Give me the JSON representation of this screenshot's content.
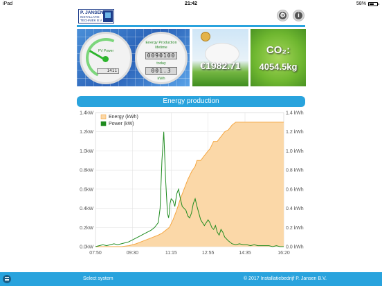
{
  "status_bar": {
    "device": "iPad",
    "time": "21:42",
    "battery": "58%",
    "battery_level": 0.58
  },
  "logo": {
    "line1": "P. JANSEN",
    "line2": "INSTALLATIE",
    "line3": "TECHNIEK B.V."
  },
  "tiles": {
    "pv_power": {
      "gauge_label": "PV Power",
      "gauge_digits": "1411",
      "meter_title_1": "Energy Production",
      "meter_title_2": "lifetime",
      "lifetime_value": "0090100",
      "today_label": "today",
      "today_value": "001.3",
      "unit": "kWh"
    },
    "money": {
      "value": "€1982.71"
    },
    "co2": {
      "label": "CO₂:",
      "value": "4054.5kg"
    }
  },
  "chart_section": {
    "title": "Energy production"
  },
  "chart_data": {
    "type": "line",
    "title": "",
    "legend": {
      "placement": "top-left",
      "entries": [
        "Energy (kWh)",
        "Power (kW)"
      ]
    },
    "x_tick_labels": [
      "07:50",
      "09:30",
      "11:15",
      "12:55",
      "14:35",
      "16:20"
    ],
    "x_tick_minutes": [
      470,
      570,
      675,
      775,
      875,
      980
    ],
    "xlim": [
      470,
      980
    ],
    "left_axis": {
      "unit": "kW",
      "ylim": [
        0,
        1.4
      ],
      "ticks": [
        "0.0kW",
        "0.2kW",
        "0.4kW",
        "0.6kW",
        "0.8kW",
        "1.0kW",
        "1.2kW",
        "1.4kW"
      ]
    },
    "right_axis": {
      "unit": "kWh",
      "ylim": [
        0,
        1.4
      ],
      "ticks": [
        "0.0 kWh",
        "0.2 kWh",
        "0.4 kWh",
        "0.6 kWh",
        "0.8 kWh",
        "1.0 kWh",
        "1.2 kWh",
        "1.4 kWh"
      ]
    },
    "grid": true,
    "series": [
      {
        "name": "Energy (kWh)",
        "type": "area",
        "color": "#f5a742",
        "fill": "#fbd8a8",
        "x": [
          470,
          540,
          560,
          580,
          600,
          620,
          640,
          650,
          660,
          670,
          680,
          690,
          700,
          710,
          720,
          730,
          740,
          745,
          755,
          765,
          775,
          780,
          790,
          800,
          810,
          820,
          830,
          840,
          850,
          860,
          870,
          900,
          930,
          960,
          980
        ],
        "y": [
          0.0,
          0.0,
          0.01,
          0.03,
          0.06,
          0.09,
          0.12,
          0.14,
          0.17,
          0.2,
          0.28,
          0.38,
          0.5,
          0.6,
          0.7,
          0.78,
          0.84,
          0.9,
          0.9,
          0.95,
          1.0,
          1.02,
          1.1,
          1.1,
          1.15,
          1.2,
          1.22,
          1.27,
          1.3,
          1.3,
          1.3,
          1.3,
          1.3,
          1.3,
          1.3
        ]
      },
      {
        "name": "Power (kW)",
        "type": "line",
        "color": "#1e8b1e",
        "x": [
          470,
          480,
          490,
          500,
          510,
          520,
          530,
          540,
          550,
          560,
          570,
          580,
          590,
          600,
          610,
          620,
          630,
          640,
          645,
          650,
          655,
          660,
          665,
          668,
          670,
          672,
          675,
          680,
          685,
          690,
          695,
          700,
          705,
          710,
          715,
          720,
          725,
          730,
          735,
          740,
          745,
          750,
          755,
          760,
          765,
          770,
          775,
          780,
          785,
          790,
          795,
          800,
          805,
          810,
          815,
          820,
          830,
          840,
          850,
          860,
          870,
          880,
          890,
          900,
          910,
          920,
          930,
          940,
          950,
          960,
          970,
          980
        ],
        "y": [
          0.0,
          0.01,
          0.02,
          0.01,
          0.02,
          0.03,
          0.02,
          0.03,
          0.04,
          0.05,
          0.07,
          0.09,
          0.11,
          0.13,
          0.15,
          0.17,
          0.2,
          0.25,
          0.4,
          0.9,
          1.2,
          0.7,
          0.35,
          0.3,
          0.35,
          0.45,
          0.5,
          0.48,
          0.42,
          0.55,
          0.6,
          0.5,
          0.42,
          0.4,
          0.38,
          0.32,
          0.3,
          0.35,
          0.45,
          0.5,
          0.42,
          0.35,
          0.28,
          0.25,
          0.22,
          0.25,
          0.28,
          0.25,
          0.2,
          0.18,
          0.22,
          0.15,
          0.12,
          0.18,
          0.15,
          0.1,
          0.06,
          0.03,
          0.02,
          0.03,
          0.02,
          0.02,
          0.01,
          0.02,
          0.01,
          0.01,
          0.01,
          0.01,
          0.0,
          0.01,
          0.0,
          0.0
        ]
      }
    ]
  },
  "toolbar": {
    "select_label": "Select system",
    "copyright": "© 2017 Installatiebedrijf P. Jansen B.V."
  }
}
